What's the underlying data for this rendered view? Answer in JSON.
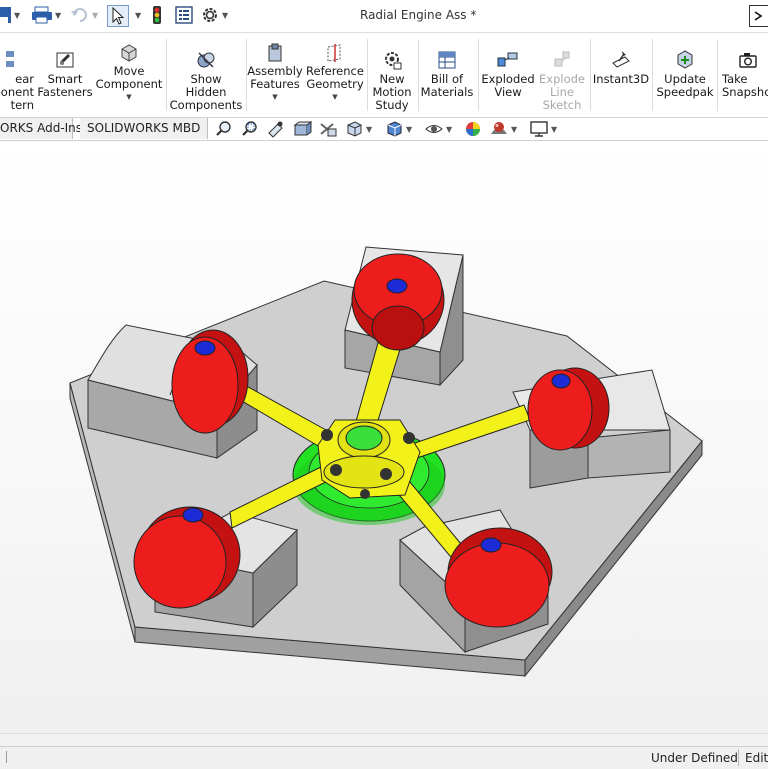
{
  "window": {
    "title": "Radial Engine Ass *"
  },
  "ribbon": {
    "buttons": [
      {
        "id": "linear-pattern",
        "label": "ear\nponent\ntern"
      },
      {
        "id": "smart-fasteners",
        "label": "Smart\nFasteners"
      },
      {
        "id": "move-component",
        "label": "Move\nComponent"
      },
      {
        "id": "show-hidden",
        "label": "Show\nHidden\nComponents"
      },
      {
        "id": "assembly-features",
        "label": "Assembly\nFeatures"
      },
      {
        "id": "reference-geometry",
        "label": "Reference\nGeometry"
      },
      {
        "id": "new-motion-study",
        "label": "New\nMotion\nStudy"
      },
      {
        "id": "bill-of-materials",
        "label": "Bill of\nMaterials"
      },
      {
        "id": "exploded-view",
        "label": "Exploded\nView"
      },
      {
        "id": "explode-line-sketch",
        "label": "Explode\nLine\nSketch"
      },
      {
        "id": "instant3d",
        "label": "Instant3D"
      },
      {
        "id": "update-speedpak",
        "label": "Update\nSpeedpak"
      },
      {
        "id": "take-snapshot",
        "label": "Take\nSnapsho"
      }
    ]
  },
  "tabs": [
    {
      "label": "ORKS Add-Ins"
    },
    {
      "label": "SOLIDWORKS MBD"
    }
  ],
  "status": {
    "state": "Under Defined",
    "mode": "Editi"
  },
  "colors": {
    "piston": "#ee1d1d",
    "rod": "#f2f21a",
    "hub": "#22e022",
    "base": "#cfcfcf",
    "pin": "#1d2bd6"
  },
  "icons": [
    "save-icon",
    "print-icon",
    "undo-icon",
    "select-icon",
    "traffic-light-icon",
    "properties-icon",
    "options-gear-icon"
  ]
}
